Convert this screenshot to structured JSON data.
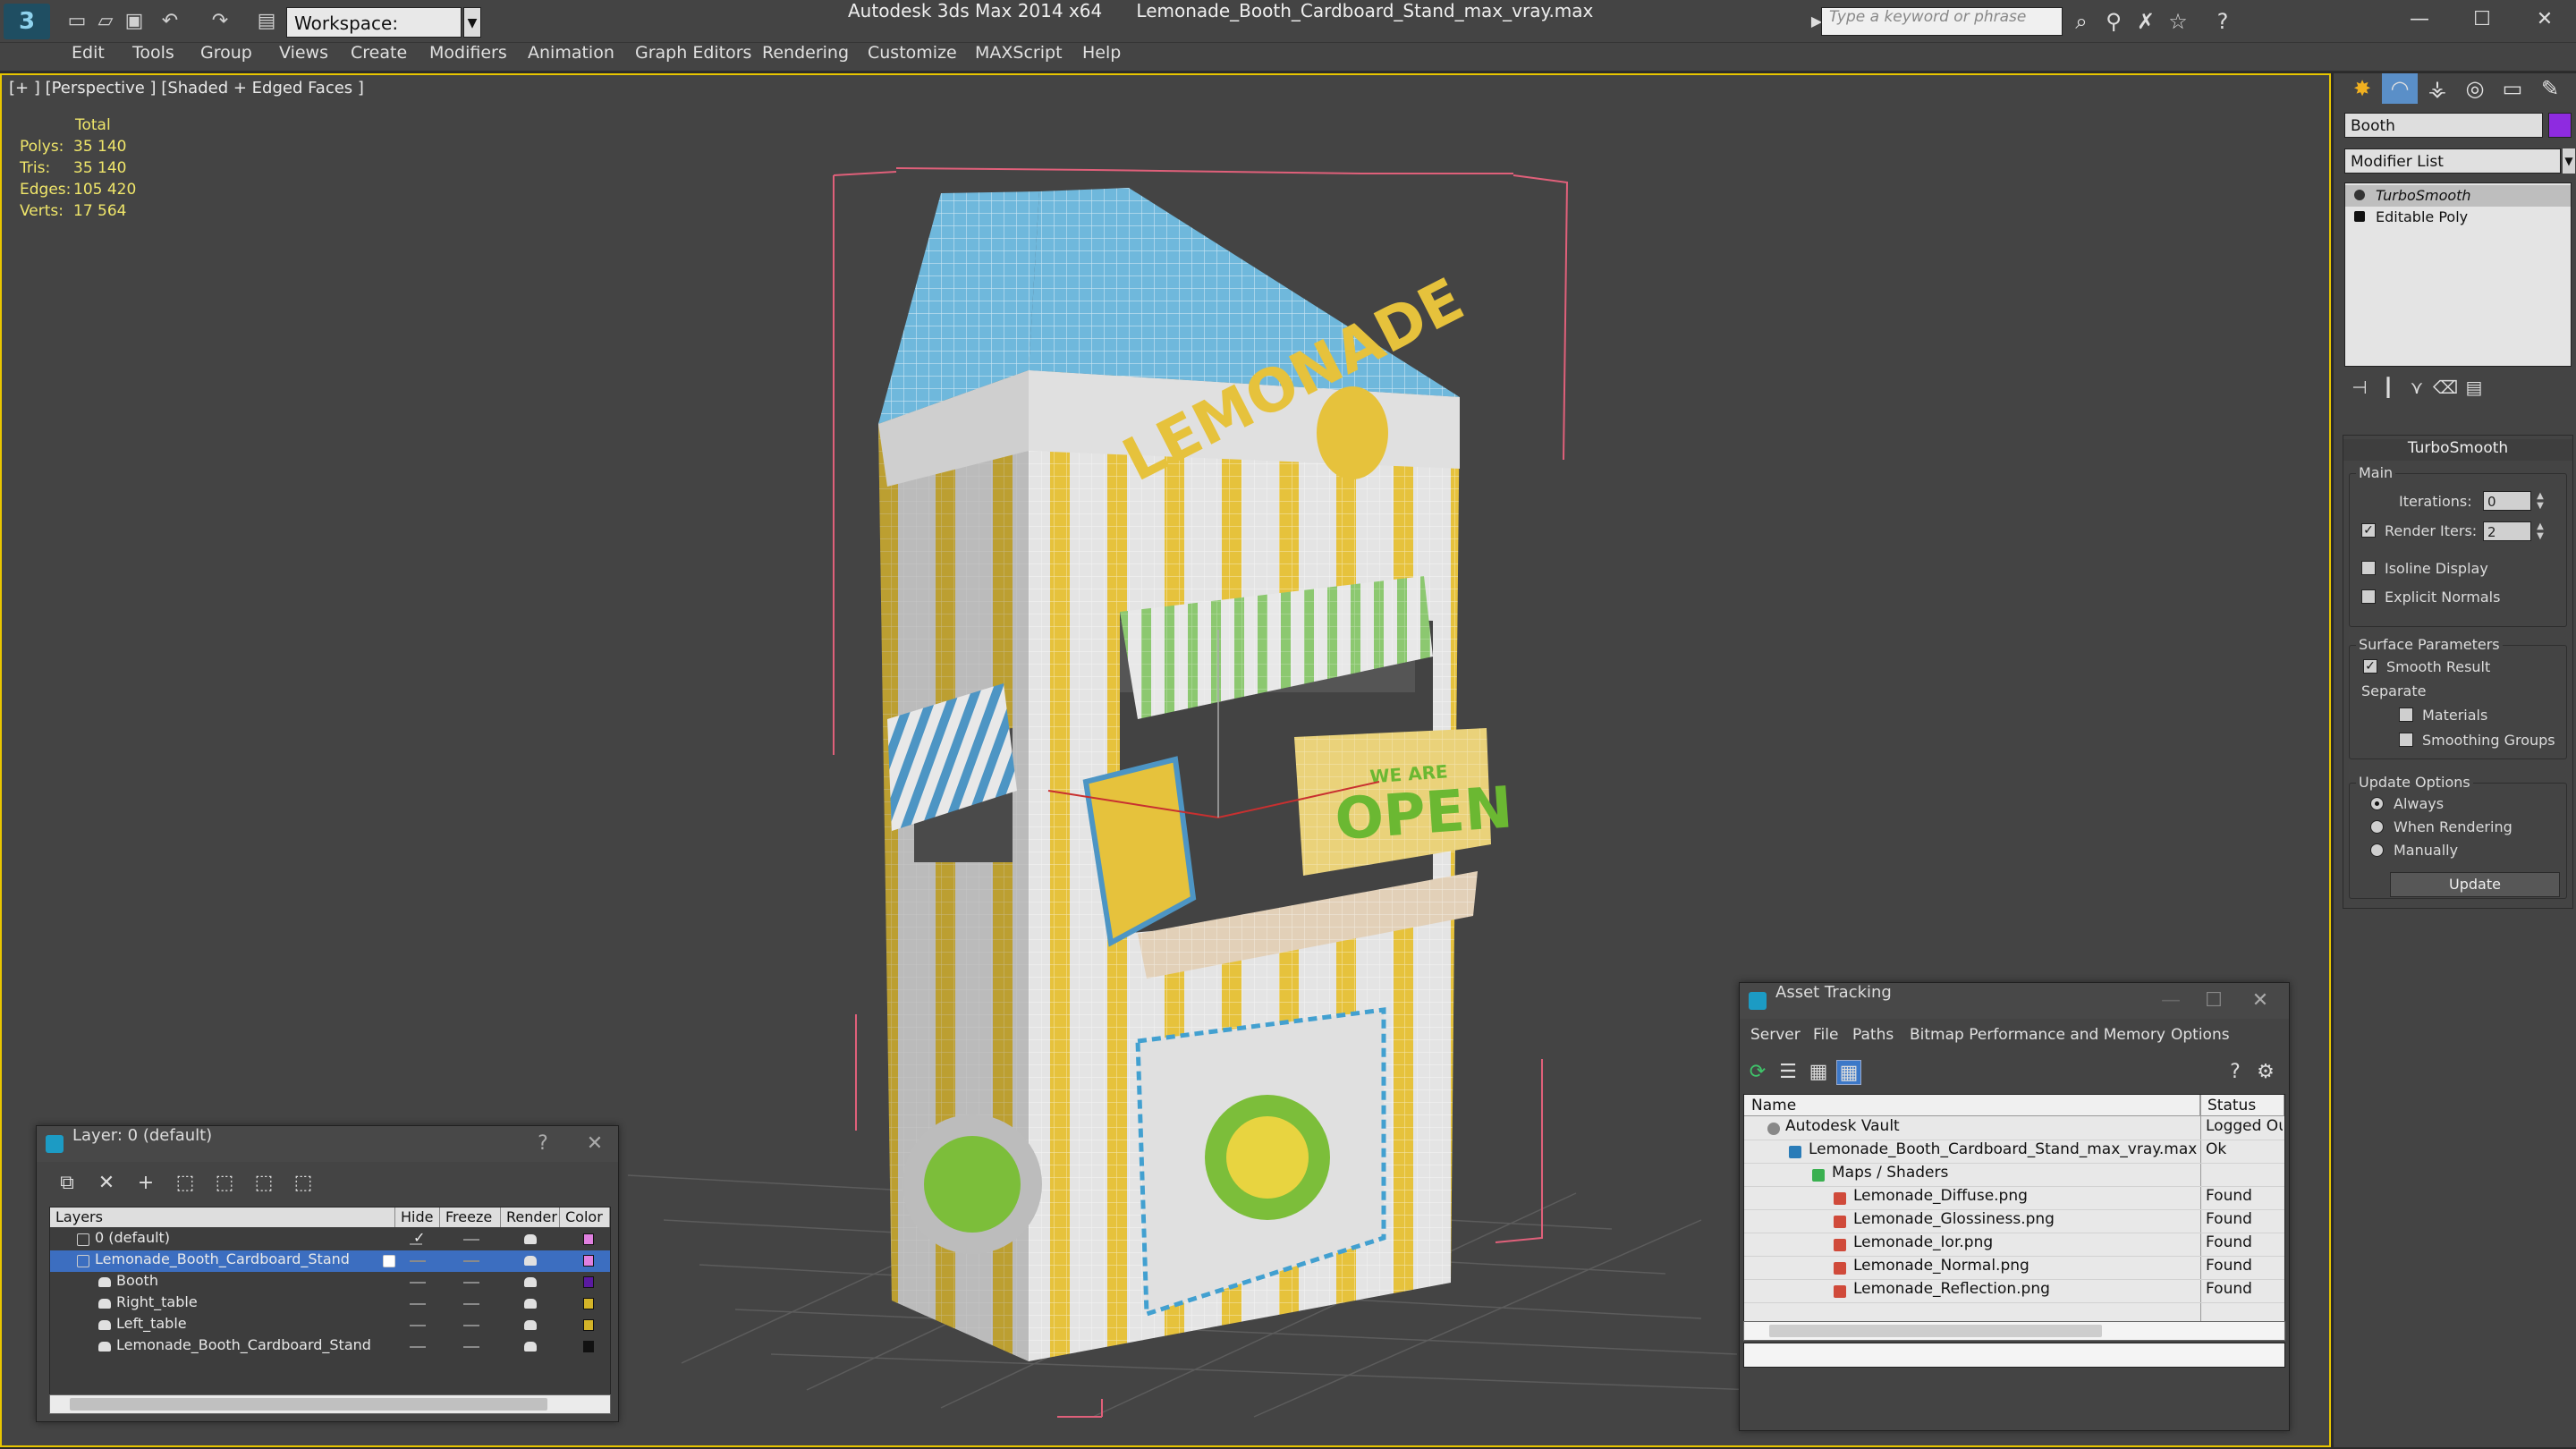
{
  "app": {
    "title": "Autodesk 3ds Max 2014 x64",
    "file": "Lemonade_Booth_Cardboard_Stand_max_vray.max",
    "workspace": "Workspace: Default",
    "search_placeholder": "Type a keyword or phrase",
    "logo_glyph": "3"
  },
  "menu": [
    "Edit",
    "Tools",
    "Group",
    "Views",
    "Create",
    "Modifiers",
    "Animation",
    "Graph Editors",
    "Rendering",
    "Customize",
    "MAXScript",
    "Help"
  ],
  "viewport": {
    "label": "[+ ] [Perspective ] [Shaded + Edged Faces ]",
    "stats_header": "Total",
    "stats": [
      {
        "label": "Polys:",
        "value": "35 140"
      },
      {
        "label": "Tris:",
        "value": "35 140"
      },
      {
        "label": "Edges:",
        "value": "105 420"
      },
      {
        "label": "Verts:",
        "value": "17 564"
      }
    ]
  },
  "command_panel": {
    "object_name": "Booth",
    "object_color": "#8e2be0",
    "modifier_list": "Modifier List",
    "stack": [
      "TurboSmooth",
      "Editable Poly"
    ],
    "rollout": {
      "title": "TurboSmooth",
      "main_label": "Main",
      "iterations_label": "Iterations:",
      "iterations_value": "0",
      "render_iters_label": "Render Iters:",
      "render_iters_value": "2",
      "isoline_label": "Isoline Display",
      "explicit_normals_label": "Explicit Normals",
      "surface_label": "Surface Parameters",
      "smooth_result_label": "Smooth Result",
      "separate_label": "Separate",
      "materials_label": "Materials",
      "smoothing_groups_label": "Smoothing Groups",
      "update_options_label": "Update Options",
      "always_label": "Always",
      "when_rendering_label": "When Rendering",
      "manually_label": "Manually",
      "update_button": "Update"
    }
  },
  "layer_window": {
    "title": "Layer: 0 (default)",
    "help": "?",
    "close": "✕",
    "columns": [
      "Layers",
      "Hide",
      "Freeze",
      "Render",
      "Color"
    ],
    "rows": [
      {
        "name": "0 (default)",
        "color": "#e080e0"
      },
      {
        "name": "Lemonade_Booth_Cardboard_Stand",
        "color": "#e080e0"
      },
      {
        "name": "Booth",
        "color": "#5a1aa0"
      },
      {
        "name": "Right_table",
        "color": "#d4b428"
      },
      {
        "name": "Left_table",
        "color": "#d4b428"
      },
      {
        "name": "Lemonade_Booth_Cardboard_Stand",
        "color": "#111111"
      }
    ]
  },
  "asset_window": {
    "title": "Asset Tracking",
    "menu": [
      "Server",
      "File",
      "Paths",
      "Bitmap Performance and Memory",
      "Options"
    ],
    "columns": [
      "Name",
      "Status"
    ],
    "rows": [
      {
        "name": "Autodesk Vault",
        "status": "Logged Out"
      },
      {
        "name": "Lemonade_Booth_Cardboard_Stand_max_vray.max",
        "status": "Ok"
      },
      {
        "name": "Maps / Shaders",
        "status": ""
      },
      {
        "name": "Lemonade_Diffuse.png",
        "status": "Found"
      },
      {
        "name": "Lemonade_Glossiness.png",
        "status": "Found"
      },
      {
        "name": "Lemonade_Ior.png",
        "status": "Found"
      },
      {
        "name": "Lemonade_Normal.png",
        "status": "Found"
      },
      {
        "name": "Lemonade_Reflection.png",
        "status": "Found"
      }
    ]
  },
  "scene": {
    "roof_text": "LEMONADE",
    "sign_text": "OPEN",
    "sign_sub": "WE ARE",
    "colors": {
      "blue": "#6fb8dc",
      "yellow": "#e6c23c",
      "white": "#e6e6e6",
      "green": "#7cbe3a",
      "stripe_green": "#8cc870"
    }
  }
}
